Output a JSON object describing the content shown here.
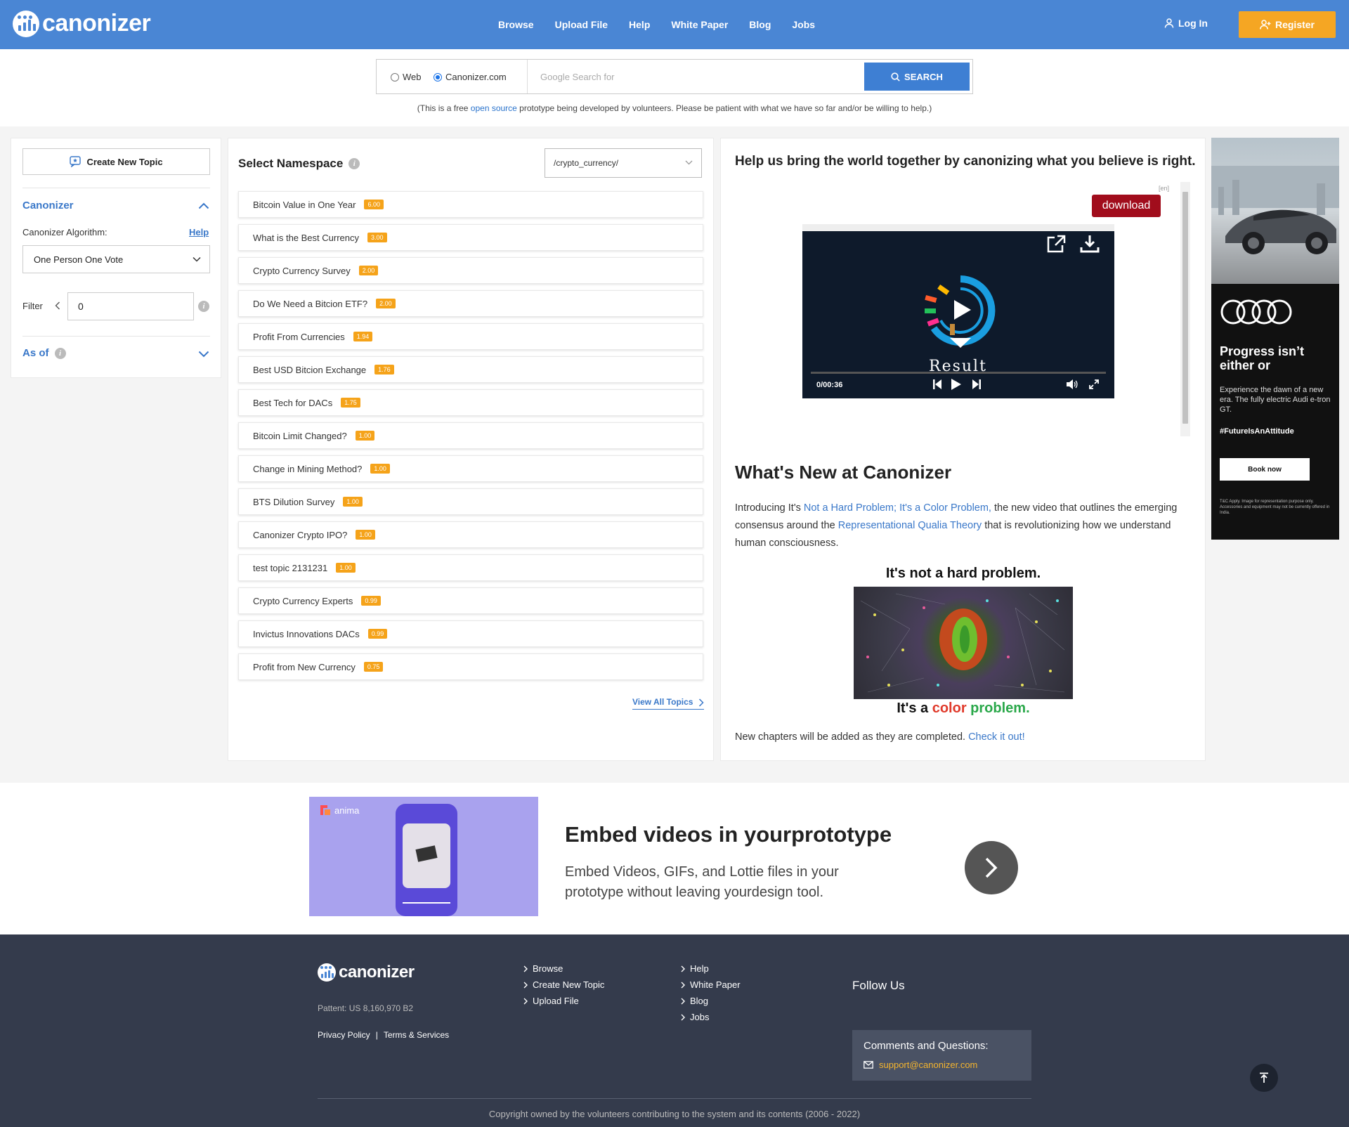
{
  "header": {
    "logo_text": "canonizer",
    "nav": [
      "Browse",
      "Upload File",
      "Help",
      "White Paper",
      "Blog",
      "Jobs"
    ],
    "login": "Log In",
    "register": "Register"
  },
  "search": {
    "radio_web": "Web",
    "radio_canonizer": "Canonizer.com",
    "selected": "Canonizer.com",
    "placeholder": "Google Search for",
    "button": "SEARCH",
    "notice_before": "(This is a free ",
    "notice_link": "open source",
    "notice_after": " prototype being developed by volunteers. Please be patient with what we have so far and/or be willing to help.)"
  },
  "sidebar": {
    "create_topic": "Create New Topic",
    "section_title": "Canonizer",
    "algorithm_label": "Canonizer Algorithm:",
    "help": "Help",
    "algorithm_value": "One Person One Vote",
    "filter_label": "Filter",
    "filter_value": "0",
    "as_of": "As of"
  },
  "topics_panel": {
    "title": "Select Namespace",
    "namespace": "/crypto_currency/",
    "topics": [
      {
        "name": "Bitcoin Value in One Year",
        "score": "6.00"
      },
      {
        "name": "What is the Best Currency",
        "score": "3.00"
      },
      {
        "name": "Crypto Currency Survey",
        "score": "2.00"
      },
      {
        "name": "Do We Need a Bitcion ETF?",
        "score": "2.00"
      },
      {
        "name": "Profit From Currencies",
        "score": "1.94"
      },
      {
        "name": "Best USD Bitcion Exchange",
        "score": "1.76"
      },
      {
        "name": "Best Tech for DACs",
        "score": "1.75"
      },
      {
        "name": "Bitcoin Limit Changed?",
        "score": "1.00"
      },
      {
        "name": "Change in Mining Method?",
        "score": "1.00"
      },
      {
        "name": "BTS Dilution Survey",
        "score": "1.00"
      },
      {
        "name": "Canonizer Crypto IPO?",
        "score": "1.00"
      },
      {
        "name": "test topic 2131231",
        "score": "1.00"
      },
      {
        "name": "Crypto Currency Experts",
        "score": "0.99"
      },
      {
        "name": "Invictus Innovations DACs",
        "score": "0.99"
      },
      {
        "name": "Profit from New Currency",
        "score": "0.75"
      }
    ],
    "view_all": "View All Topics"
  },
  "info_panel": {
    "title": "Help us bring the world together by canonizing what you believe is right.",
    "ad_lang": "[en]",
    "download": "download",
    "video_time": "0/00:36",
    "video_logo": "Result",
    "whats_new": "What's New at Canonizer",
    "intro_1": "Introducing It's ",
    "intro_link_1": "Not a Hard Problem; It's a Color Problem,",
    "intro_2": " the new video that outlines the emerging consensus around the ",
    "intro_link_2": "Representational Qualia Theory",
    "intro_3": " that is revolutionizing how we understand human consciousness.",
    "poster_top": "It's not a hard problem.",
    "poster_bottom_1": "It's a ",
    "poster_bottom_color": "color",
    "poster_bottom_problem": "problem.",
    "chapters": "New chapters will be added as they are completed. ",
    "check_it": "Check it out!"
  },
  "side_ad": {
    "headline": "Progress isn’t either or",
    "body": "Experience the dawn of a new era. The fully electric Audi e-tron GT.",
    "hashtag": "#FutureIsAnAttitude",
    "button": "Book now",
    "fineprint": "T&C Apply. Image for representation purpose only. Accessories and equipment may not be currently offered in India."
  },
  "banner_ad": {
    "brand": "anima",
    "title": "Embed videos in yourprototype",
    "text": "Embed Videos, GIFs, and Lottie files in your prototype without leaving yourdesign tool."
  },
  "footer": {
    "logo_text": "canonizer",
    "patent": "Pattent: US 8,160,970 B2",
    "privacy": "Privacy Policy",
    "terms": "Terms & Services",
    "col1": [
      "Browse",
      "Create New Topic",
      "Upload File"
    ],
    "col2": [
      "Help",
      "White Paper",
      "Blog",
      "Jobs"
    ],
    "follow": "Follow Us",
    "contact_title": "Comments and Questions:",
    "contact_email": "support@canonizer.com",
    "copyright": "Copyright owned by the volunteers contributing to the system and its contents (2006 - 2022)"
  },
  "colors": {
    "header_blue": "#4a86d4",
    "register_orange": "#f5a623",
    "score_orange": "#f5a31a",
    "footer_bg": "#343b4c",
    "link_blue": "#3a78c9"
  }
}
